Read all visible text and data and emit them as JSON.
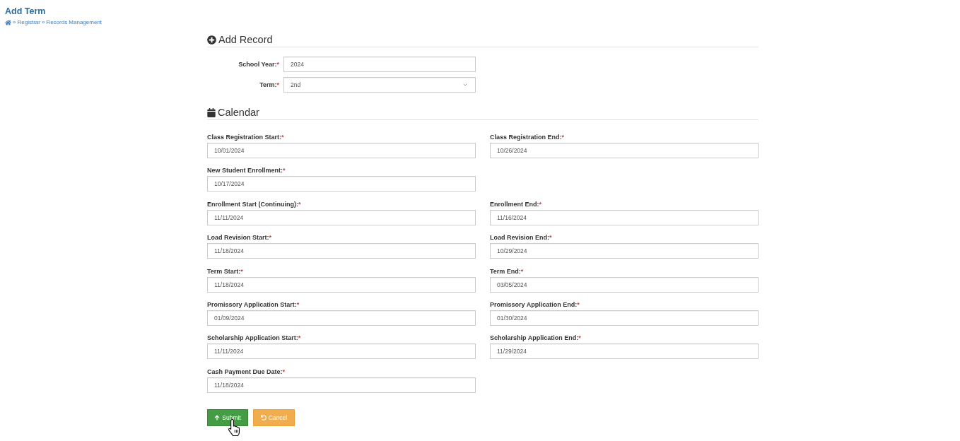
{
  "page": {
    "title": "Add Term"
  },
  "breadcrumb": [
    {
      "kind": "home",
      "separator": "»"
    },
    {
      "kind": "link",
      "label": "Registrar",
      "separator": "»"
    },
    {
      "kind": "link",
      "label": "Records Management"
    }
  ],
  "add_record": {
    "heading": "Add Record",
    "fields": [
      {
        "kind": "text",
        "label": "School Year:",
        "required_mark": "*",
        "value": "2024"
      },
      {
        "kind": "select",
        "label": "Term:",
        "required_mark": "*",
        "value": "2nd"
      }
    ]
  },
  "calendar": {
    "heading": "Calendar",
    "rows": [
      {
        "fields": [
          {
            "label": "Class Registration Start:",
            "required_mark": "*",
            "value": "10/01/2024"
          },
          {
            "label": "Class Registration End:",
            "required_mark": "*",
            "value": "10/26/2024"
          }
        ]
      },
      {
        "fields": [
          {
            "label": "New Student Enrollment:",
            "required_mark": "*",
            "value": "10/17/2024"
          }
        ]
      },
      {
        "fields": [
          {
            "label": "Enrollment Start (Continuing):",
            "required_mark": "*",
            "value": "11/11/2024"
          },
          {
            "label": "Enrollment End:",
            "required_mark": "*",
            "value": "11/16/2024"
          }
        ]
      },
      {
        "fields": [
          {
            "label": "Load Revision Start:",
            "required_mark": "*",
            "value": "11/18/2024"
          },
          {
            "label": "Load Revision End:",
            "required_mark": "*",
            "value": "10/29/2024"
          }
        ]
      },
      {
        "fields": [
          {
            "label": "Term Start:",
            "required_mark": "*",
            "value": "11/18/2024"
          },
          {
            "label": "Term End:",
            "required_mark": "*",
            "value": "03/05/2024"
          }
        ]
      },
      {
        "fields": [
          {
            "label": "Promissory Application Start:",
            "required_mark": "*",
            "value": "01/09/2024"
          },
          {
            "label": "Promissory Application End:",
            "required_mark": "*",
            "value": "01/30/2024"
          }
        ]
      },
      {
        "fields": [
          {
            "label": "Scholarship Application Start:",
            "required_mark": "*",
            "value": "11/11/2024"
          },
          {
            "label": "Scholarship Application End:",
            "required_mark": "*",
            "value": "11/29/2024"
          }
        ]
      },
      {
        "fields": [
          {
            "label": "Cash Payment Due Date:",
            "required_mark": "*",
            "value": "11/18/2024"
          }
        ]
      }
    ]
  },
  "buttons": [
    {
      "kind": "submit",
      "label": "Submit"
    },
    {
      "kind": "cancel",
      "label": "Cancel"
    }
  ]
}
